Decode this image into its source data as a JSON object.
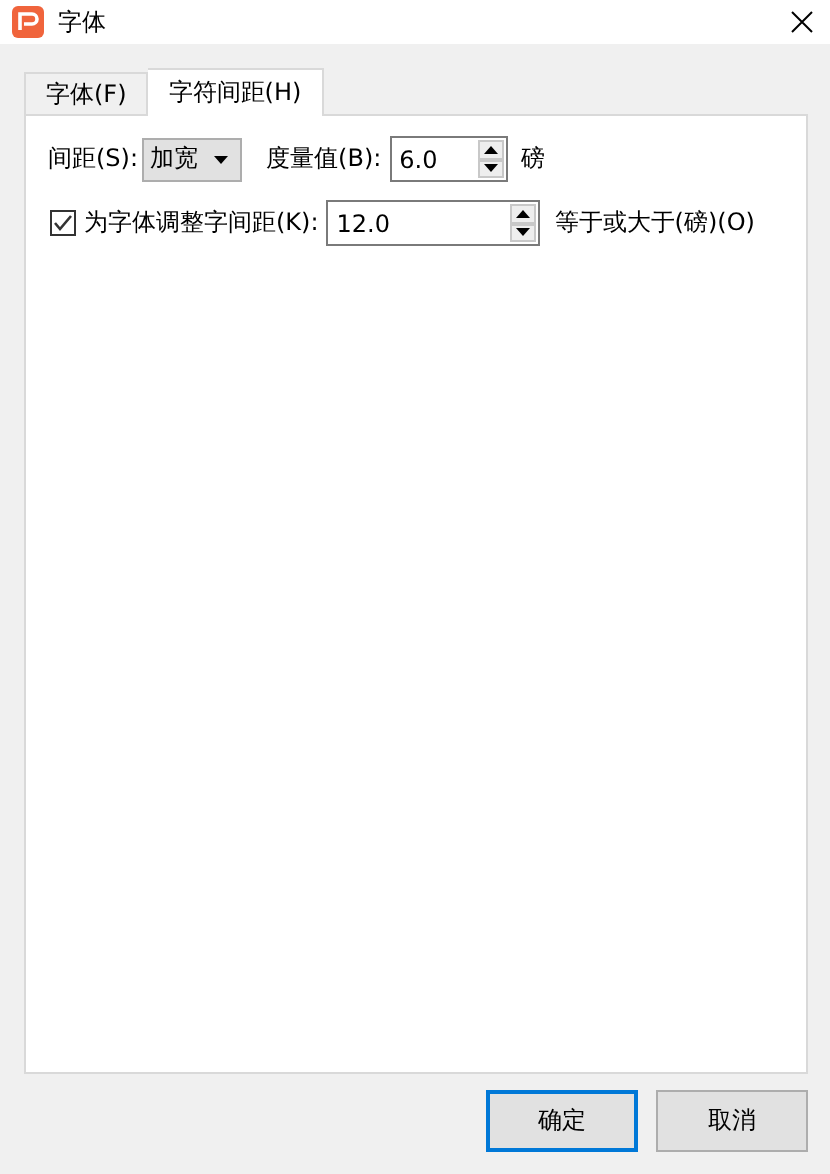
{
  "window": {
    "title": "字体"
  },
  "tabs": [
    {
      "label": "字体(F)",
      "selected": false
    },
    {
      "label": "字符间距(H)",
      "selected": true
    }
  ],
  "spacing": {
    "label": "间距(S):",
    "value": "加宽"
  },
  "measure": {
    "label": "度量值(B):",
    "value": "6.0",
    "unit": "磅"
  },
  "kerning": {
    "label": "为字体调整字间距(K):",
    "checked": true,
    "value": "12.0",
    "suffix": "等于或大于(磅)(O)"
  },
  "buttons": [
    {
      "label": "确定",
      "default": true
    },
    {
      "label": "取消",
      "default": false
    }
  ]
}
